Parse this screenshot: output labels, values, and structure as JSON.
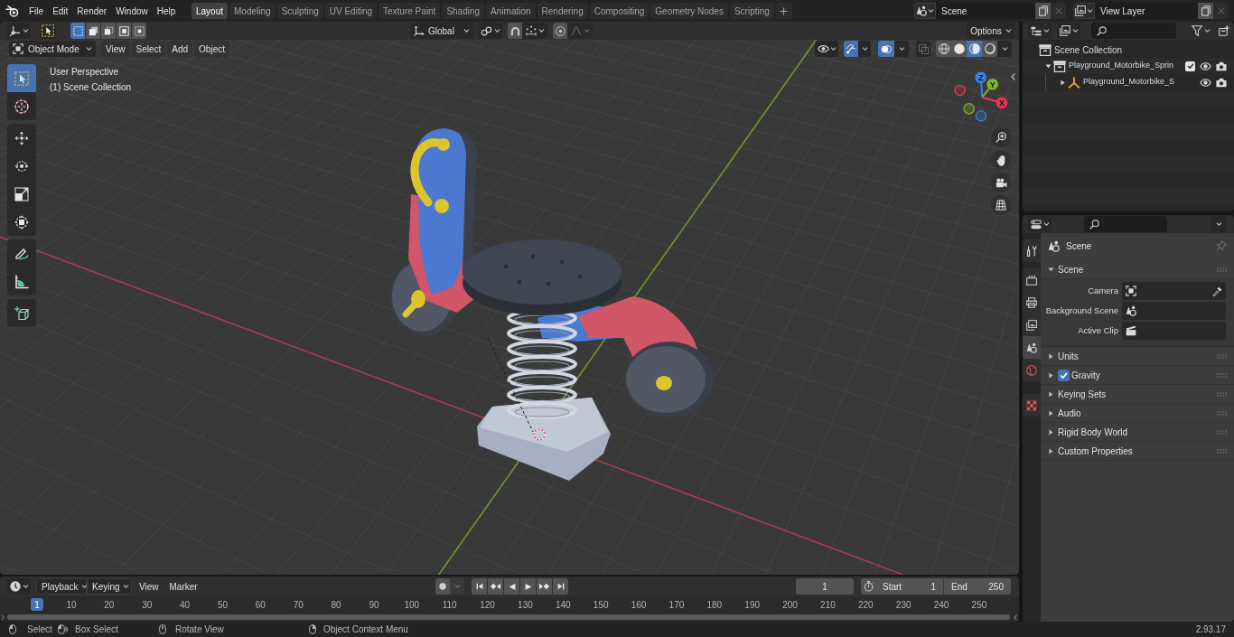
{
  "top_bar": {
    "menus": [
      "File",
      "Edit",
      "Render",
      "Window",
      "Help"
    ],
    "workspaces": [
      {
        "label": "Layout",
        "selected": true
      },
      {
        "label": "Modeling",
        "selected": false
      },
      {
        "label": "Sculpting",
        "selected": false
      },
      {
        "label": "UV Editing",
        "selected": false
      },
      {
        "label": "Texture Paint",
        "selected": false
      },
      {
        "label": "Shading",
        "selected": false
      },
      {
        "label": "Animation",
        "selected": false
      },
      {
        "label": "Rendering",
        "selected": false
      },
      {
        "label": "Compositing",
        "selected": false
      },
      {
        "label": "Geometry Nodes",
        "selected": false
      },
      {
        "label": "Scripting",
        "selected": false
      }
    ],
    "scene": "Scene",
    "view_layer": "View Layer"
  },
  "viewport": {
    "tool_header": {
      "select_modes": [
        {
          "kind": "set",
          "selected": true
        },
        {
          "kind": "extend",
          "selected": false
        },
        {
          "kind": "subtract",
          "selected": false
        },
        {
          "kind": "invert",
          "selected": false
        },
        {
          "kind": "intersect",
          "selected": false
        }
      ],
      "transform_orientation": "Global",
      "options": "Options"
    },
    "header": {
      "mode": "Object Mode",
      "menus": [
        "View",
        "Select",
        "Add",
        "Object"
      ],
      "gizmos": {
        "on": true
      },
      "overlays": {
        "on": true
      },
      "xray": {
        "on": false
      },
      "shading_modes": [
        {
          "kind": "wireframe",
          "selected": false
        },
        {
          "kind": "solid",
          "selected": false
        },
        {
          "kind": "material",
          "selected": true
        },
        {
          "kind": "rendered",
          "selected": false
        }
      ]
    },
    "overlay_text": [
      "User Perspective",
      "(1) Scene Collection"
    ],
    "toolbar": [
      [
        {
          "kind": "select",
          "selected": true
        },
        {
          "kind": "cursor",
          "selected": false
        }
      ],
      [
        {
          "kind": "move",
          "selected": false
        },
        {
          "kind": "rotate",
          "selected": false
        },
        {
          "kind": "scale",
          "selected": false
        },
        {
          "kind": "transform",
          "selected": false
        }
      ],
      [
        {
          "kind": "annotate",
          "selected": false
        },
        {
          "kind": "measure",
          "selected": false
        }
      ],
      [
        {
          "kind": "addcube",
          "selected": false
        }
      ]
    ],
    "navigation_gizmo": [
      {
        "label": "X",
        "color": "#e8384f"
      },
      {
        "label": "Y",
        "color": "#7fb52a"
      },
      {
        "label": "Z",
        "color": "#3584e4"
      }
    ]
  },
  "outliner": {
    "items": [
      {
        "kind": "scene",
        "label": "Scene Collection",
        "children": [
          {
            "kind": "collection",
            "label": "Playground_Motorbike_Sprin",
            "expanded": true,
            "checkbox": {
              "checked": true
            },
            "children": [
              {
                "kind": "object",
                "label": "Playground_Motorbike_S",
                "expanded": false
              }
            ]
          }
        ]
      }
    ]
  },
  "properties": {
    "tab_groups": [
      [
        {
          "kind": "tool",
          "selected": false
        }
      ],
      [
        {
          "kind": "render",
          "selected": false
        },
        {
          "kind": "output",
          "selected": false
        },
        {
          "kind": "viewlayer",
          "selected": false
        },
        {
          "kind": "scene",
          "selected": true
        },
        {
          "kind": "world",
          "selected": false
        }
      ],
      [
        {
          "kind": "texture",
          "selected": false
        }
      ]
    ],
    "context": "Scene",
    "panels": [
      {
        "title": "Scene",
        "expanded": true,
        "fields": [
          {
            "kind": "camera",
            "label": "Camera"
          },
          {
            "kind": "scene",
            "label": "Background Scene"
          },
          {
            "kind": "clip",
            "label": "Active Clip"
          }
        ]
      },
      {
        "title": "Units",
        "expanded": false
      },
      {
        "title": "Gravity",
        "expanded": false,
        "checkbox": {
          "checked": true
        }
      },
      {
        "title": "Keying Sets",
        "expanded": false
      },
      {
        "title": "Audio",
        "expanded": false
      },
      {
        "title": "Rigid Body World",
        "expanded": false
      },
      {
        "title": "Custom Properties",
        "expanded": false
      }
    ]
  },
  "timeline": {
    "dropdowns": [
      "Playback",
      "Keying"
    ],
    "menus": [
      "View",
      "Marker"
    ],
    "current_frame": "1",
    "start": {
      "label": "Start",
      "value": "1"
    },
    "end": {
      "label": "End",
      "value": "250"
    },
    "ruler": {
      "current": "1",
      "labels": [
        "10",
        "20",
        "30",
        "40",
        "50",
        "60",
        "70",
        "80",
        "90",
        "100",
        "110",
        "120",
        "130",
        "140",
        "150",
        "160",
        "170",
        "180",
        "190",
        "200",
        "210",
        "220",
        "230",
        "240",
        "250"
      ]
    }
  },
  "status_bar": {
    "hints": [
      {
        "kind": "left",
        "label": "Select"
      },
      {
        "kind": "drag",
        "label": "Box Select"
      },
      {
        "kind": "middle",
        "label": "Rotate View"
      },
      {
        "kind": "right",
        "label": "Object Context Menu"
      }
    ],
    "version": "2.93.17"
  }
}
